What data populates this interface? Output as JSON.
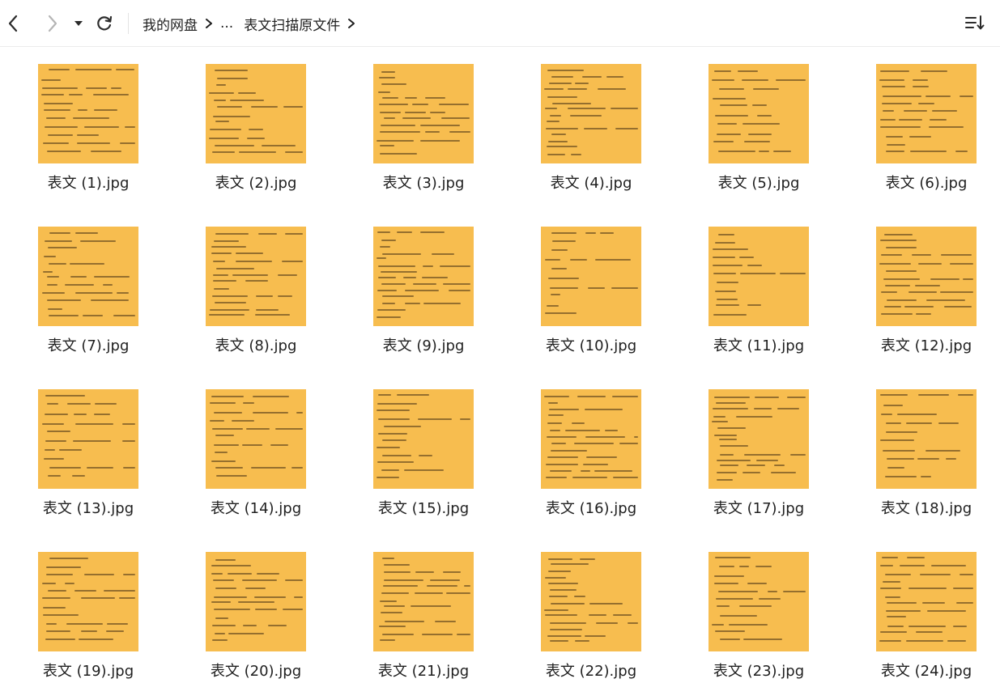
{
  "toolbar": {
    "icons": {
      "back": "chevron-left-icon",
      "forward": "chevron-right-icon",
      "history": "caret-down-icon",
      "refresh": "refresh-icon",
      "sort": "sort-list-icon"
    },
    "breadcrumb": {
      "root": "我的网盘",
      "ellipsis": "...",
      "current": "表文扫描原文件"
    }
  },
  "colors": {
    "thumbnail": "#f7bd4f",
    "text": "#1f1f1f",
    "icon_active": "#2b2b2b",
    "icon_disabled": "#b5b5b5"
  },
  "files": [
    {
      "name": "表文 (1).jpg"
    },
    {
      "name": "表文 (2).jpg"
    },
    {
      "name": "表文 (3).jpg"
    },
    {
      "name": "表文 (4).jpg"
    },
    {
      "name": "表文 (5).jpg"
    },
    {
      "name": "表文 (6).jpg"
    },
    {
      "name": "表文 (7).jpg"
    },
    {
      "name": "表文 (8).jpg"
    },
    {
      "name": "表文 (9).jpg"
    },
    {
      "name": "表文 (10).jpg"
    },
    {
      "name": "表文 (11).jpg"
    },
    {
      "name": "表文 (12).jpg"
    },
    {
      "name": "表文 (13).jpg"
    },
    {
      "name": "表文 (14).jpg"
    },
    {
      "name": "表文 (15).jpg"
    },
    {
      "name": "表文 (16).jpg"
    },
    {
      "name": "表文 (17).jpg"
    },
    {
      "name": "表文 (18).jpg"
    },
    {
      "name": "表文 (19).jpg"
    },
    {
      "name": "表文 (20).jpg"
    },
    {
      "name": "表文 (21).jpg"
    },
    {
      "name": "表文 (22).jpg"
    },
    {
      "name": "表文 (23).jpg"
    },
    {
      "name": "表文 (24).jpg"
    }
  ]
}
